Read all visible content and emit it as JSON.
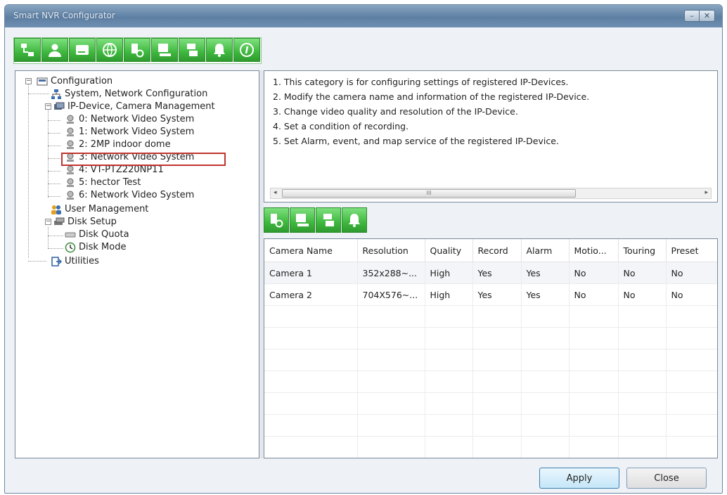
{
  "window": {
    "title": "Smart NVR Configurator",
    "minimize_label": "–",
    "close_label": "✕"
  },
  "toolbar": {
    "items": [
      {
        "name": "system-network-icon"
      },
      {
        "name": "user-icon"
      },
      {
        "name": "disk-icon"
      },
      {
        "name": "network-globe-icon"
      },
      {
        "name": "camera-settings-icon"
      },
      {
        "name": "recording-icon"
      },
      {
        "name": "alarm-device-icon"
      },
      {
        "name": "bell-icon"
      },
      {
        "name": "info-icon"
      }
    ]
  },
  "tree": {
    "root": "Configuration",
    "system_network": "System, Network Configuration",
    "ip_device": "IP-Device, Camera Management",
    "devices": [
      "0: Network Video System",
      "1: Network Video System",
      "2: 2MP indoor dome",
      "3: Network Video System",
      "4: VT-PTZ220NP11",
      "5: hector Test",
      "6: Network Video System"
    ],
    "user_management": "User Management",
    "disk_setup": "Disk Setup",
    "disk_quota": "Disk Quota",
    "disk_mode": "Disk Mode",
    "utilities": "Utilities",
    "expander_minus": "−"
  },
  "description": {
    "lines": [
      "1. This category is for configuring settings of registered IP-Devices.",
      "2. Modify the camera name and information of the registered IP-Device.",
      "3. Change video quality and resolution of the IP-Device.",
      "4. Set a condition of recording.",
      "5. Set Alarm, event, and map service of the registered IP-Device."
    ],
    "scroll_thumb": "III",
    "scroll_left": "◂",
    "scroll_right": "▸"
  },
  "sub_toolbar": {
    "items": [
      {
        "name": "camera-settings-icon"
      },
      {
        "name": "recording-icon"
      },
      {
        "name": "alarm-device-icon"
      },
      {
        "name": "bell-icon"
      }
    ]
  },
  "grid": {
    "headers": [
      "Camera Name",
      "Resolution",
      "Quality",
      "Record",
      "Alarm",
      "Motio...",
      "Touring",
      "Preset"
    ],
    "rows": [
      [
        "Camera 1",
        "352x288~...",
        "High",
        "Yes",
        "Yes",
        "No",
        "No",
        "No"
      ],
      [
        "Camera 2",
        "704X576~...",
        "High",
        "Yes",
        "Yes",
        "No",
        "No",
        "No"
      ]
    ]
  },
  "footer": {
    "apply_label": "Apply",
    "close_label": "Close"
  }
}
